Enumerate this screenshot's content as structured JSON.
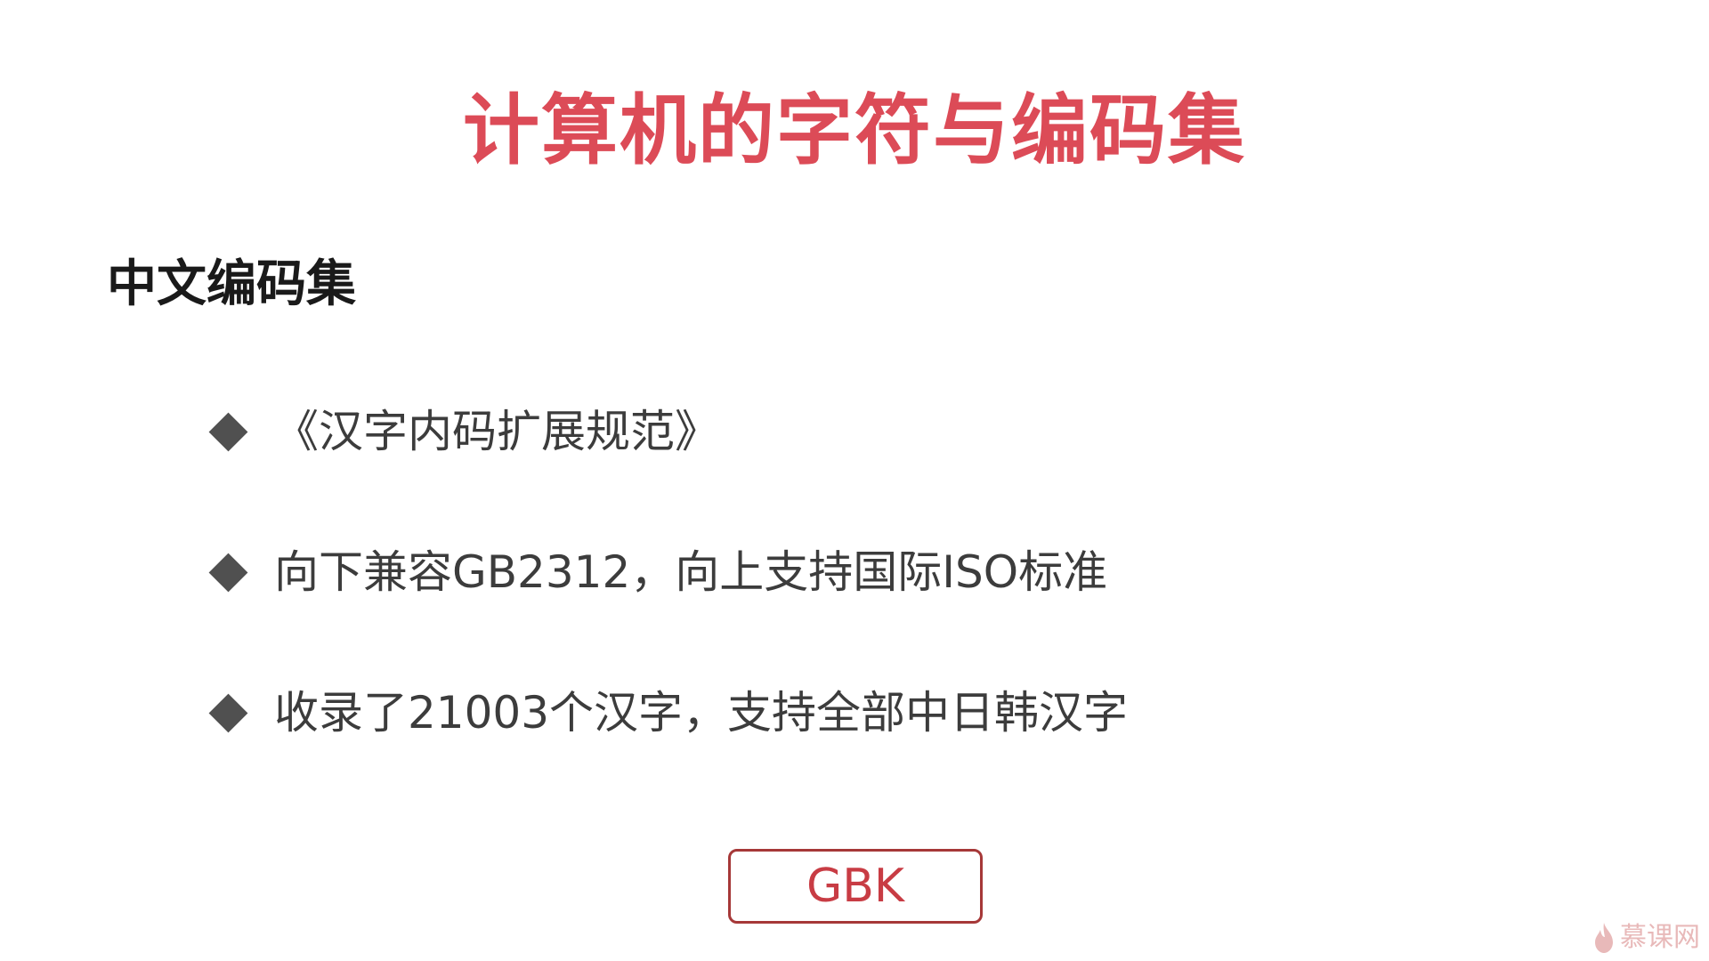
{
  "slide": {
    "title": "计算机的字符与编码集",
    "section_heading": "中文编码集",
    "bullets": [
      "《汉字内码扩展规范》",
      "向下兼容GB2312，向上支持国际ISO标准",
      "收录了21003个汉字，支持全部中日韩汉字"
    ],
    "highlight_box": "GBK",
    "watermark": "慕课网"
  },
  "colors": {
    "title": "#dc4b57",
    "heading": "#1a1a1a",
    "bullet_text": "#3c3c3c",
    "bullet_marker": "#505050",
    "box_border": "#a63838",
    "box_text": "#c83c44"
  },
  "icons": {
    "bullet_marker": "diamond-icon",
    "watermark_logo": "flame-icon"
  }
}
